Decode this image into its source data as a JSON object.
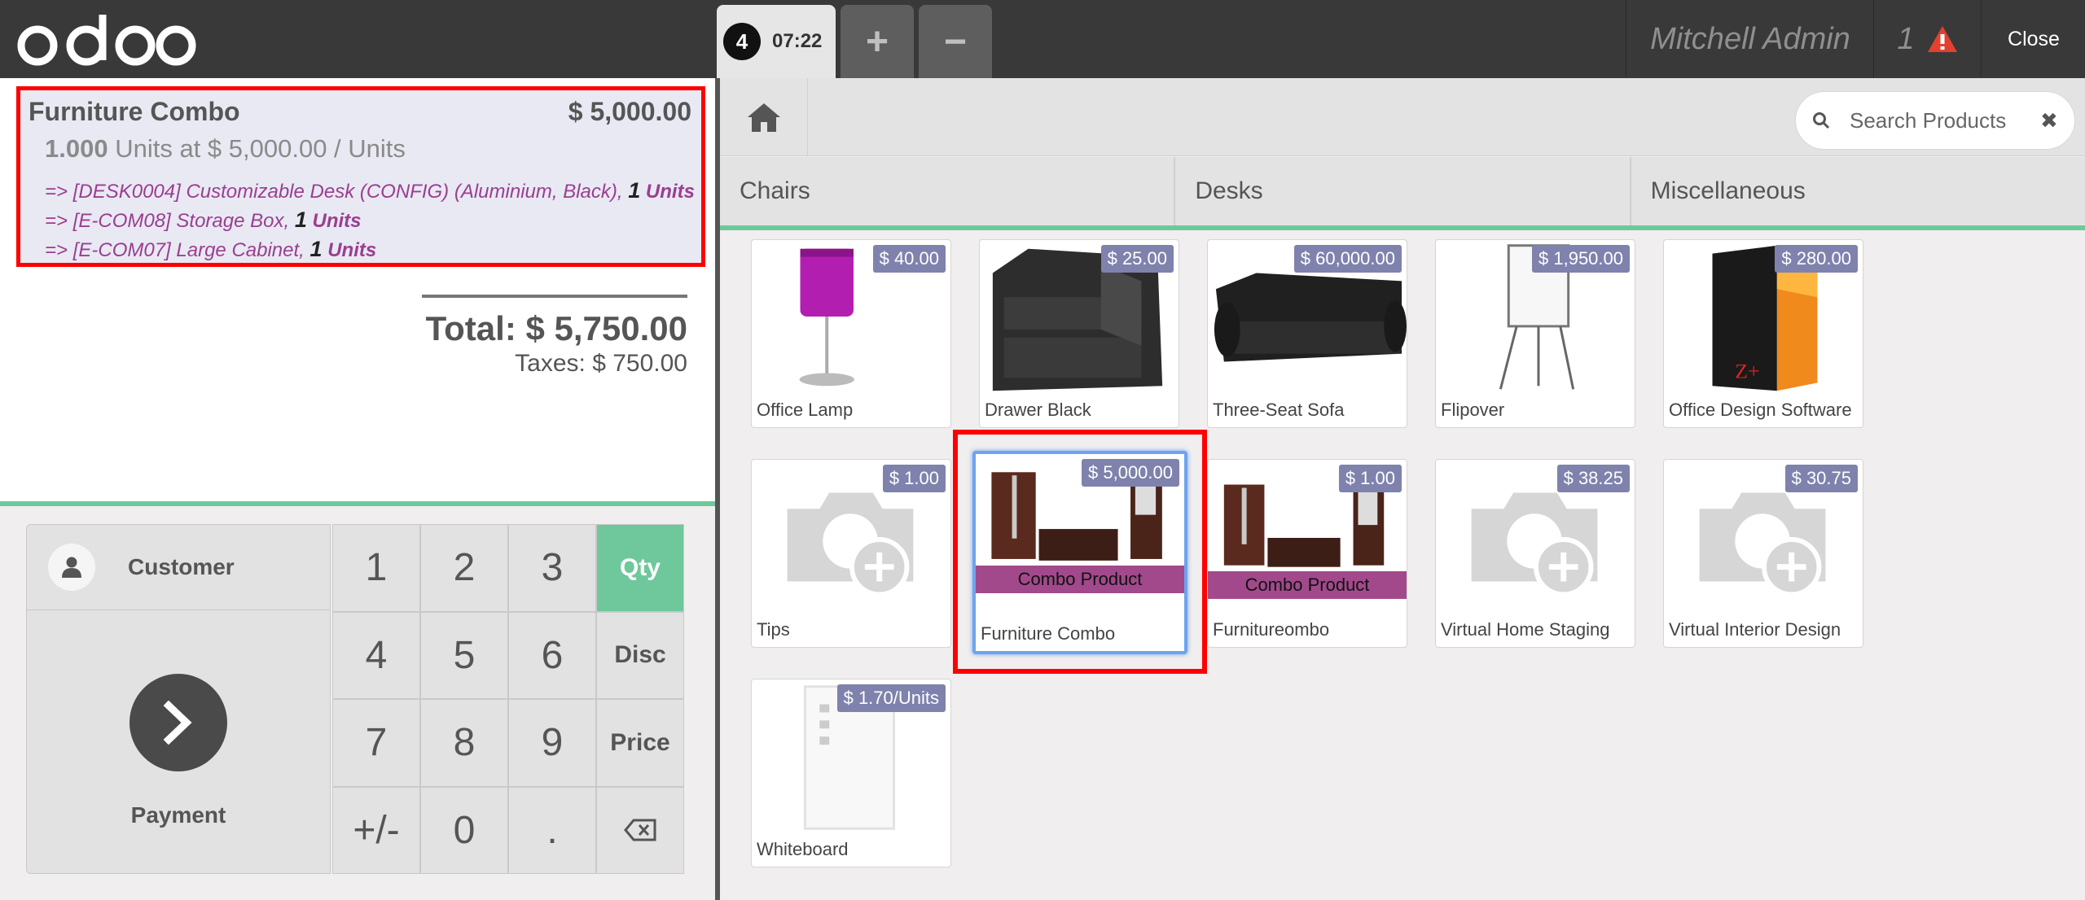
{
  "header": {
    "logo_text": "odoo",
    "order": {
      "number": "4",
      "time": "07:22"
    },
    "add_order_label": "+",
    "remove_order_label": "−",
    "cashier": "Mitchell Admin",
    "notification_count": "1",
    "close_label": "Close"
  },
  "orderline": {
    "product_name": "Furniture Combo",
    "price": "$ 5,000.00",
    "quantity": "1.000",
    "unit_info": "Units at $ 5,000.00 / Units",
    "combo_items": [
      {
        "text": "=> [DESK0004] Customizable Desk (CONFIG) (Aluminium, Black),",
        "qty": "1",
        "unit": "Units"
      },
      {
        "text": "=> [E-COM08] Storage Box,",
        "qty": "1",
        "unit": "Units"
      },
      {
        "text": "=> [E-COM07] Large Cabinet,",
        "qty": "1",
        "unit": "Units"
      }
    ]
  },
  "summary": {
    "total": "Total: $ 5,750.00",
    "taxes": "Taxes: $ 750.00"
  },
  "controls": {
    "customer_label": "Customer",
    "payment_label": "Payment",
    "numpad_keys": [
      "1",
      "2",
      "3",
      "Qty",
      "4",
      "5",
      "6",
      "Disc",
      "7",
      "8",
      "9",
      "Price",
      "+/-",
      "0",
      ".",
      "⌫"
    ],
    "active_mode": "Qty"
  },
  "search": {
    "placeholder": "Search Products"
  },
  "categories": [
    "Chairs",
    "Desks",
    "Miscellaneous"
  ],
  "products": [
    {
      "name": "Office Lamp",
      "price": "$ 40.00",
      "image": "lamp"
    },
    {
      "name": "Drawer Black",
      "price": "$ 25.00",
      "image": "drawer"
    },
    {
      "name": "Three-Seat Sofa",
      "price": "$ 60,000.00",
      "image": "sofa"
    },
    {
      "name": "Flipover",
      "price": "$ 1,950.00",
      "image": "flipover"
    },
    {
      "name": "Office Design Software",
      "price": "$ 280.00",
      "image": "software-box"
    },
    {
      "name": "Tips",
      "price": "$ 1.00",
      "image": "camera-placeholder"
    },
    {
      "name": "Furniture Combo",
      "price": "$ 5,000.00",
      "image": "furniture-set",
      "ribbon": "Combo Product",
      "selected": true
    },
    {
      "name": "Furnitureombo",
      "price": "$ 1.00",
      "image": "furniture-set",
      "ribbon": "Combo Product"
    },
    {
      "name": "Virtual Home Staging",
      "price": "$ 38.25",
      "image": "camera-placeholder"
    },
    {
      "name": "Virtual Interior Design",
      "price": "$ 30.75",
      "image": "camera-placeholder"
    },
    {
      "name": "Whiteboard",
      "price": "$ 1.70/Units",
      "image": "whiteboard"
    }
  ],
  "colors": {
    "header_bg": "#393939",
    "accent_green": "#6ec89b",
    "price_tag": "#7f82ac",
    "combo_ribbon": "#a2498c",
    "combo_text": "#9b3e90",
    "highlight_red": "#ff0000",
    "selection_blue": "#6fa3ef"
  }
}
